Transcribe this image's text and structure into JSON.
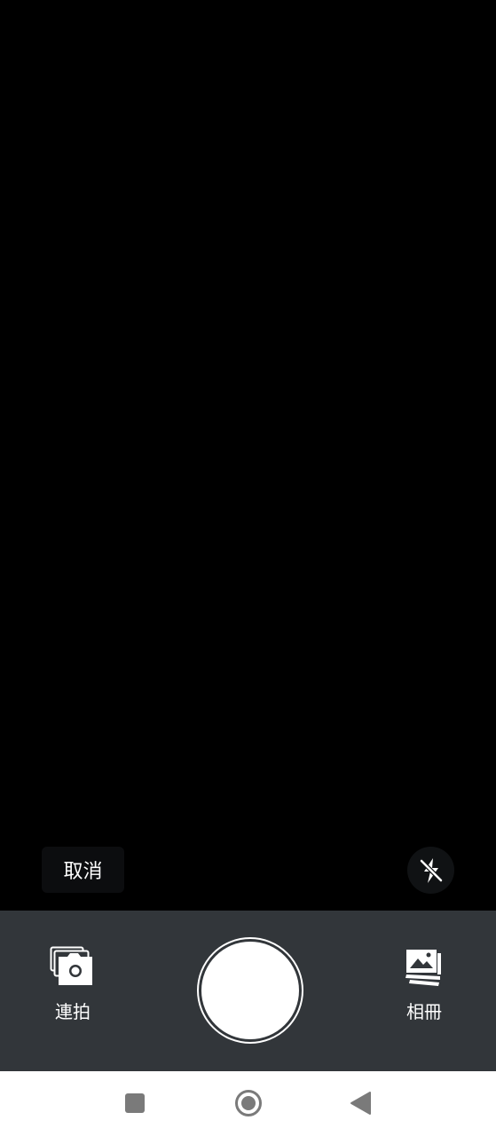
{
  "viewfinder": {
    "cancel_label": "取消"
  },
  "controls": {
    "burst_label": "連拍",
    "album_label": "相冊"
  },
  "icons": {
    "flash": "flash-off-icon",
    "burst": "burst-camera-icon",
    "album": "photo-stack-icon",
    "nav_recents": "square-icon",
    "nav_home": "circle-icon",
    "nav_back": "triangle-back-icon"
  },
  "colors": {
    "viewfinder_bg": "#000000",
    "control_bar_bg": "#32363a",
    "nav_bar_bg": "#ffffff",
    "nav_icon": "#7a7a7a"
  }
}
